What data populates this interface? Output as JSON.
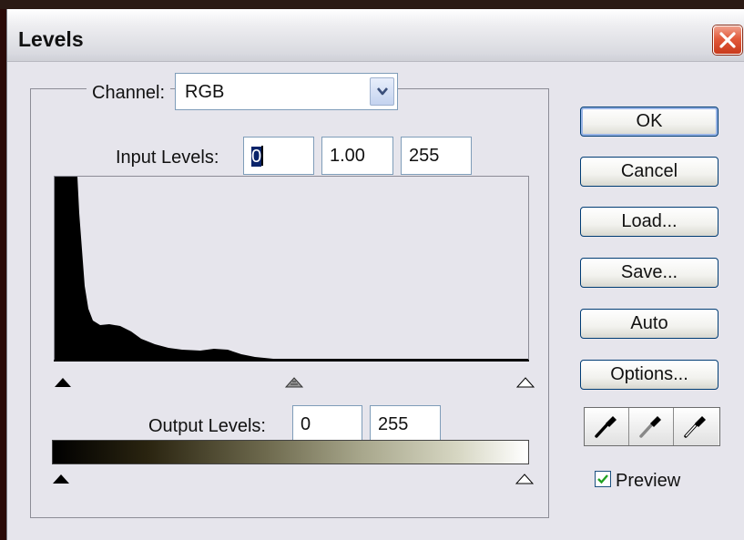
{
  "window": {
    "title": "Levels"
  },
  "channel": {
    "label": "Channel:",
    "value": "RGB"
  },
  "input_levels": {
    "label": "Input Levels:",
    "black": "0",
    "gamma": "1.00",
    "white": "255"
  },
  "output_levels": {
    "label": "Output Levels:",
    "black": "0",
    "white": "255"
  },
  "buttons": {
    "ok": "OK",
    "cancel": "Cancel",
    "load": "Load...",
    "save": "Save...",
    "auto": "Auto",
    "options": "Options..."
  },
  "preview": {
    "label": "Preview",
    "checked": true
  },
  "icons": {
    "close": "close-x-icon",
    "dropdown": "chevron-down-icon",
    "black_eyedropper": "eyedropper-black-icon",
    "gray_eyedropper": "eyedropper-gray-icon",
    "white_eyedropper": "eyedropper-white-icon"
  },
  "colors": {
    "accent": "#0a246a",
    "close_red": "#e25a3b",
    "dialog_bg": "#e6e5ec"
  }
}
